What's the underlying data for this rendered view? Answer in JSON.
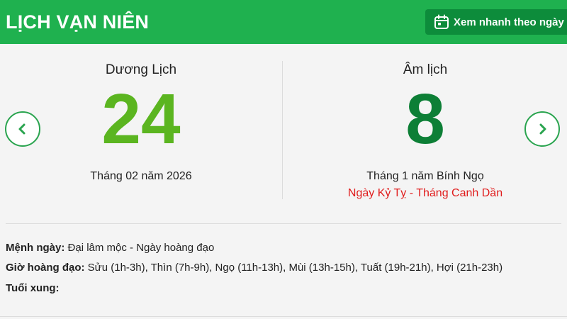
{
  "header": {
    "brand": "LỊCH VẠN NIÊN",
    "quick_view_label": "Xem nhanh theo ngày",
    "bg_color": "#1fb14f"
  },
  "solar": {
    "title": "Dương Lịch",
    "day": "24",
    "month_year": "Tháng 02 năm 2026",
    "color": "#5bb520"
  },
  "lunar": {
    "title": "Âm lịch",
    "day": "8",
    "month_year": "Tháng 1 năm Bính Ngọ",
    "can_chi": "Ngày Kỷ Tỵ - Tháng Canh Dần",
    "color": "#0d7f36",
    "can_chi_color": "#e01b1b"
  },
  "nav": {
    "prev_icon": "chevron-left-icon",
    "next_icon": "chevron-right-icon"
  },
  "details": {
    "menh_label": "Mệnh ngày:",
    "menh_value": "Đại lâm mộc - Ngày hoàng đạo",
    "gio_label": "Giờ hoàng đạo:",
    "gio_value": "Sửu (1h-3h), Thìn (7h-9h), Ngọ (11h-13h), Mùi (13h-15h), Tuất (19h-21h), Hợi (21h-23h)",
    "tuoi_label": "Tuổi xung:",
    "tuoi_value": ""
  }
}
